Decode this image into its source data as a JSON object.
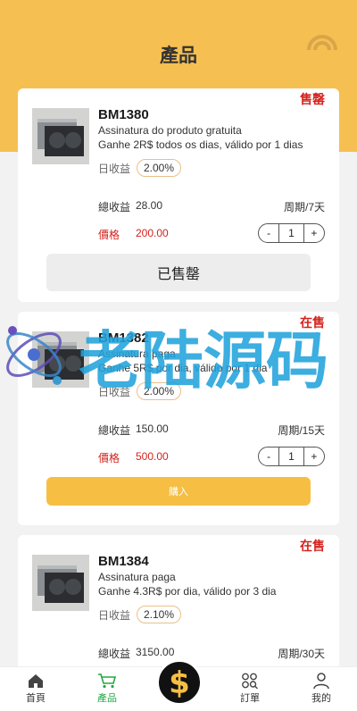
{
  "page": {
    "title": "產品"
  },
  "colors": {
    "brand": "#f6bf52",
    "sold_out": "#d4231d",
    "active_tab": "#23a843"
  },
  "labels": {
    "daily_income": "日收益",
    "total_income": "總收益",
    "price": "價格",
    "minus": "-",
    "plus": "+"
  },
  "products": [
    {
      "status": "售罄",
      "name": "BM1380",
      "desc1": "Assinatura do produto gratuita",
      "desc2": "Ganhe 2R$ todos os dias, válido por 1 dias",
      "daily": "2.00%",
      "total": "28.00",
      "period": "周期/7天",
      "price": "200.00",
      "qty": "1",
      "button": "已售罄"
    },
    {
      "status": "在售",
      "name": "BM1382",
      "desc1": "Assinatura paga",
      "desc2": "Ganhe 5R$ por dia, válido por 1 dia",
      "daily": "2.00%",
      "total": "150.00",
      "period": "周期/15天",
      "price": "500.00",
      "qty": "1",
      "button": "購入"
    },
    {
      "status": "在售",
      "name": "BM1384",
      "desc1": "Assinatura paga",
      "desc2": "Ganhe 4.3R$ por dia, válido por 3 dia",
      "daily": "2.10%",
      "total": "3150.00",
      "period": "周期/30天"
    }
  ],
  "watermark": {
    "text": "老陆源码"
  },
  "tabbar": [
    {
      "label": "首頁",
      "icon": "home-icon"
    },
    {
      "label": "產品",
      "icon": "cart-icon"
    },
    {
      "label": "",
      "icon": "dollar-icon"
    },
    {
      "label": "訂單",
      "icon": "grid-search-icon"
    },
    {
      "label": "我的",
      "icon": "user-icon"
    }
  ]
}
